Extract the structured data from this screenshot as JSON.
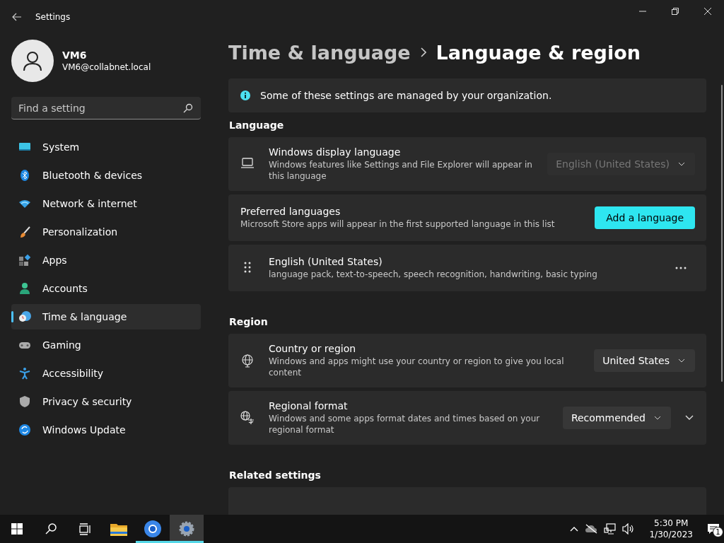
{
  "window": {
    "title": "Settings"
  },
  "user": {
    "name": "VM6",
    "email": "VM6@collabnet.local"
  },
  "search": {
    "placeholder": "Find a setting"
  },
  "nav": [
    {
      "label": "System",
      "selected": false
    },
    {
      "label": "Bluetooth & devices",
      "selected": false
    },
    {
      "label": "Network & internet",
      "selected": false
    },
    {
      "label": "Personalization",
      "selected": false
    },
    {
      "label": "Apps",
      "selected": false
    },
    {
      "label": "Accounts",
      "selected": false
    },
    {
      "label": "Time & language",
      "selected": true
    },
    {
      "label": "Gaming",
      "selected": false
    },
    {
      "label": "Accessibility",
      "selected": false
    },
    {
      "label": "Privacy & security",
      "selected": false
    },
    {
      "label": "Windows Update",
      "selected": false
    }
  ],
  "breadcrumb": {
    "parent": "Time & language",
    "current": "Language & region"
  },
  "notice": "Some of these settings are managed by your organization.",
  "sections": [
    {
      "heading": "Language",
      "cards": [
        {
          "kind": "dropdown",
          "title": "Windows display language",
          "description": "Windows features like Settings and File Explorer will appear in this language",
          "value": "English (United States)",
          "disabled": true
        },
        {
          "kind": "button",
          "title": "Preferred languages",
          "description": "Microsoft Store apps will appear in the first supported language in this list",
          "button": "Add a language"
        },
        {
          "kind": "language",
          "title": "English (United States)",
          "description": "language pack, text-to-speech, speech recognition, handwriting, basic typing"
        }
      ]
    },
    {
      "heading": "Region",
      "cards": [
        {
          "kind": "dropdown",
          "title": "Country or region",
          "description": "Windows and apps might use your country or region to give you local content",
          "value": "United States",
          "disabled": false
        },
        {
          "kind": "dropdown",
          "title": "Regional format",
          "description": "Windows and some apps format dates and times based on your regional format",
          "value": "Recommended",
          "disabled": false,
          "expanded": false
        }
      ]
    },
    {
      "heading": "Related settings",
      "cards": [
        {
          "kind": "partial"
        }
      ]
    }
  ],
  "taskbar": {
    "apps": [
      {
        "running": false,
        "selected": false
      },
      {
        "running": true,
        "selected": false
      },
      {
        "running": true,
        "selected": true
      }
    ],
    "time": "5:30 PM",
    "date": "1/30/2023",
    "notifications": "1"
  }
}
